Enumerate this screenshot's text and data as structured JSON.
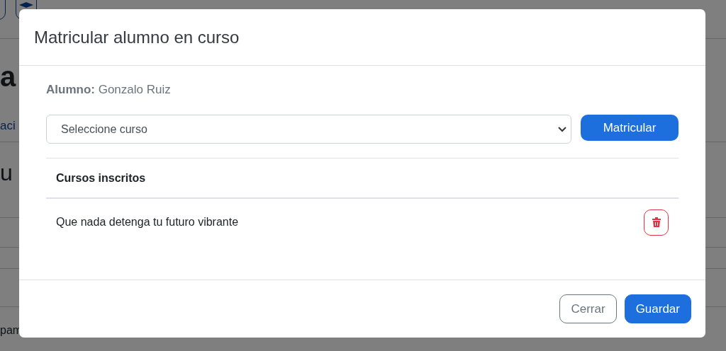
{
  "background": {
    "heading": "a",
    "link": "aci",
    "subheading": "u",
    "footer_text": "pam"
  },
  "modal": {
    "title": "Matricular alumno en curso",
    "student": {
      "label": "Alumno:",
      "name": "Gonzalo Ruiz"
    },
    "course_select": {
      "value": "Seleccione curso"
    },
    "enroll_button": "Matricular",
    "table": {
      "columns": [
        "Cursos inscritos"
      ],
      "rows": [
        {
          "course": "Que nada detenga tu futuro vibrante"
        }
      ]
    },
    "buttons": [
      {
        "label": "Cerrar",
        "kind": "secondary"
      },
      {
        "label": "Guardar",
        "kind": "primary"
      }
    ]
  }
}
